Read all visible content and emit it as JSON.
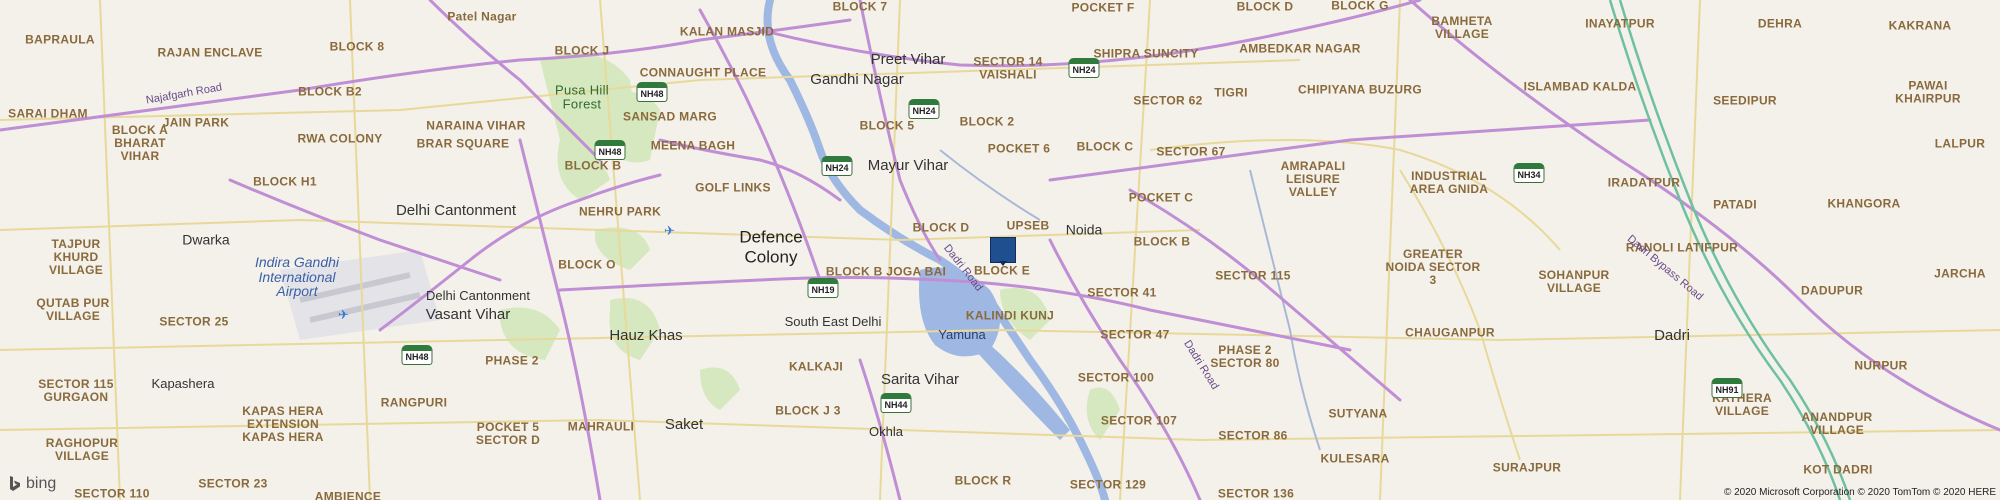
{
  "map": {
    "labels": [
      {
        "text": "Patel Nagar",
        "cls": "locality"
      },
      {
        "text": "KALAN MASJID",
        "cls": ""
      },
      {
        "text": "BLOCK 7",
        "cls": ""
      },
      {
        "text": "POCKET F",
        "cls": ""
      },
      {
        "text": "BLOCK D",
        "cls": ""
      },
      {
        "text": "BLOCK G",
        "cls": ""
      },
      {
        "text": "BAMHETA VILLAGE",
        "cls": ""
      },
      {
        "text": "INAYATPUR",
        "cls": ""
      },
      {
        "text": "DEHRA",
        "cls": ""
      },
      {
        "text": "KAKRANA",
        "cls": ""
      },
      {
        "text": "BAPRAULA",
        "cls": ""
      },
      {
        "text": "BLOCK 8",
        "cls": ""
      },
      {
        "text": "BLOCK J",
        "cls": ""
      },
      {
        "text": "CONNAUGHT PLACE",
        "cls": ""
      },
      {
        "text": "Preet Vihar",
        "cls": "locality"
      },
      {
        "text": "SECTOR 14",
        "cls": ""
      },
      {
        "text": "VAISHALI",
        "cls": ""
      },
      {
        "text": "SHIPRA SUNCITY",
        "cls": ""
      },
      {
        "text": "AMBEDKAR NAGAR",
        "cls": ""
      },
      {
        "text": "RAJAN ENCLAVE",
        "cls": ""
      },
      {
        "text": "Gandhi Nagar",
        "cls": "locality"
      },
      {
        "text": "TIGRI",
        "cls": ""
      },
      {
        "text": "CHIPIYANA BUZURG",
        "cls": ""
      },
      {
        "text": "ISLAMBAD KALDA",
        "cls": ""
      },
      {
        "text": "SEEDIPUR",
        "cls": ""
      },
      {
        "text": "PAWAI",
        "cls": ""
      },
      {
        "text": "KHAIRPUR",
        "cls": ""
      },
      {
        "text": "BLOCK B2",
        "cls": ""
      },
      {
        "text": "Pusa Hill Forest",
        "cls": "park"
      },
      {
        "text": "SECTOR 62",
        "cls": ""
      },
      {
        "text": "SARAI DHAM",
        "cls": ""
      },
      {
        "text": "JAIN PARK",
        "cls": ""
      },
      {
        "text": "SANSAD MARG",
        "cls": ""
      },
      {
        "text": "BLOCK 5",
        "cls": ""
      },
      {
        "text": "BLOCK 2",
        "cls": ""
      },
      {
        "text": "NARAINA VIHAR",
        "cls": ""
      },
      {
        "text": "BLOCK A BHARAT VIHAR",
        "cls": ""
      },
      {
        "text": "RWA COLONY",
        "cls": ""
      },
      {
        "text": "BRAR SQUARE",
        "cls": ""
      },
      {
        "text": "MEENA BAGH",
        "cls": ""
      },
      {
        "text": "POCKET 6",
        "cls": ""
      },
      {
        "text": "BLOCK C",
        "cls": ""
      },
      {
        "text": "Mayur Vihar",
        "cls": "locality"
      },
      {
        "text": "SECTOR 67",
        "cls": ""
      },
      {
        "text": "LALPUR",
        "cls": ""
      },
      {
        "text": "BLOCK B",
        "cls": ""
      },
      {
        "text": "AMRAPALI LEISURE VALLEY",
        "cls": ""
      },
      {
        "text": "INDUSTRIAL AREA GNIDA",
        "cls": ""
      },
      {
        "text": "IRADATPUR",
        "cls": ""
      },
      {
        "text": "BLOCK H1",
        "cls": ""
      },
      {
        "text": "GOLF LINKS",
        "cls": ""
      },
      {
        "text": "Delhi Cantonment",
        "cls": "locality"
      },
      {
        "text": "NEHRU PARK",
        "cls": ""
      },
      {
        "text": "UPSEB",
        "cls": ""
      },
      {
        "text": "BLOCK D",
        "cls": ""
      },
      {
        "text": "Noida",
        "cls": "locality"
      },
      {
        "text": "POCKET C",
        "cls": ""
      },
      {
        "text": "PATADI",
        "cls": ""
      },
      {
        "text": "KHANGORA",
        "cls": ""
      },
      {
        "text": "Dwarka",
        "cls": "locality"
      },
      {
        "text": "Defence Colony",
        "cls": "city"
      },
      {
        "text": "BLOCK B",
        "cls": ""
      },
      {
        "text": "RANOLI LATIFPUR",
        "cls": ""
      },
      {
        "text": "TAJPUR KHURD VILLAGE",
        "cls": ""
      },
      {
        "text": "BLOCK O",
        "cls": ""
      },
      {
        "text": "BLOCK B JOGA BAI",
        "cls": ""
      },
      {
        "text": "BLOCK E",
        "cls": ""
      },
      {
        "text": "SECTOR 115",
        "cls": ""
      },
      {
        "text": "GREATER NOIDA SECTOR 3",
        "cls": ""
      },
      {
        "text": "SOHANPUR VILLAGE",
        "cls": ""
      },
      {
        "text": "JARCHA",
        "cls": ""
      },
      {
        "text": "Indira Gandhi International Airport",
        "cls": "airport"
      },
      {
        "text": "QUTAB PUR VILLAGE",
        "cls": ""
      },
      {
        "text": "Delhi Cantonment",
        "cls": "small"
      },
      {
        "text": "SECTOR 41",
        "cls": ""
      },
      {
        "text": "DADUPUR",
        "cls": ""
      },
      {
        "text": "Vasant Vihar",
        "cls": "locality"
      },
      {
        "text": "KALINDI KUNJ",
        "cls": ""
      },
      {
        "text": "South East Delhi",
        "cls": "small"
      },
      {
        "text": "SECTOR 25",
        "cls": ""
      },
      {
        "text": "Hauz Khas",
        "cls": "locality"
      },
      {
        "text": "Yamuna",
        "cls": "water"
      },
      {
        "text": "SECTOR 47",
        "cls": ""
      },
      {
        "text": "CHAUGANPUR",
        "cls": ""
      },
      {
        "text": "Dadri",
        "cls": "locality"
      },
      {
        "text": "PHASE 2 SECTOR 80",
        "cls": ""
      },
      {
        "text": "PHASE 2",
        "cls": ""
      },
      {
        "text": "KALKAJI",
        "cls": ""
      },
      {
        "text": "SECTOR 100",
        "cls": ""
      },
      {
        "text": "NURPUR",
        "cls": ""
      },
      {
        "text": "Kapashera",
        "cls": "small"
      },
      {
        "text": "Sarita Vihar",
        "cls": "locality"
      },
      {
        "text": "SECTOR 115 GURGAON",
        "cls": ""
      },
      {
        "text": "RANGPURI",
        "cls": ""
      },
      {
        "text": "BLOCK J 3",
        "cls": ""
      },
      {
        "text": "KATHERA VILLAGE",
        "cls": ""
      },
      {
        "text": "SUTYANA",
        "cls": ""
      },
      {
        "text": "ANANDPUR VILLAGE",
        "cls": ""
      },
      {
        "text": "KAPAS HERA EXTENSION KAPAS HERA",
        "cls": ""
      },
      {
        "text": "MAHRAULI",
        "cls": ""
      },
      {
        "text": "Saket",
        "cls": "locality"
      },
      {
        "text": "SECTOR 107",
        "cls": ""
      },
      {
        "text": "POCKET 5 SECTOR D",
        "cls": ""
      },
      {
        "text": "Okhla",
        "cls": "small"
      },
      {
        "text": "SECTOR 86",
        "cls": ""
      },
      {
        "text": "RAGHOPUR VILLAGE",
        "cls": ""
      },
      {
        "text": "KULESARA",
        "cls": ""
      },
      {
        "text": "SURAJPUR",
        "cls": ""
      },
      {
        "text": "KOT DADRI",
        "cls": ""
      },
      {
        "text": "SECTOR 23",
        "cls": ""
      },
      {
        "text": "BLOCK R",
        "cls": ""
      },
      {
        "text": "SECTOR 129",
        "cls": ""
      },
      {
        "text": "SECTOR 110",
        "cls": ""
      },
      {
        "text": "AMBIENCE",
        "cls": ""
      },
      {
        "text": "SECTOR 136",
        "cls": ""
      },
      {
        "text": "Najafgarh Road",
        "cls": "road"
      },
      {
        "text": "Dadri Road",
        "cls": "road"
      },
      {
        "text": "Dadri Road",
        "cls": "road"
      },
      {
        "text": "Dadri Bypass Road",
        "cls": "road"
      }
    ],
    "shields": [
      "NH48",
      "NH24",
      "NH24",
      "NH24",
      "NH48",
      "NH19",
      "NH48",
      "NH44",
      "NH34",
      "NH91"
    ],
    "logo": "bing",
    "attribution": "© 2020 Microsoft Corporation © 2020 TomTom © 2020 HERE",
    "colors": {
      "background": "#f3f1ea",
      "highway": "#c08ed4",
      "water": "#9fb8e3",
      "park": "#cfe3b5",
      "marker": "#1f4f8f"
    }
  }
}
